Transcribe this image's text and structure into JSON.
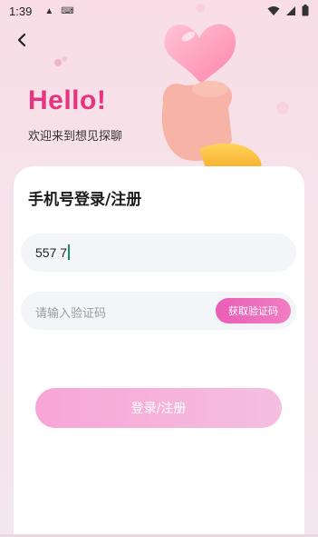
{
  "status_bar": {
    "time": "1:39",
    "icons": [
      "notification-a-icon",
      "keyboard-icon",
      "wifi-icon",
      "signal-icon",
      "battery-icon"
    ]
  },
  "header": {
    "back_icon": "chevron-left-icon",
    "greeting": "Hello!",
    "welcome": "欢迎来到想见探聊"
  },
  "login": {
    "title": "手机号登录/注册",
    "phone_value": "557 7",
    "code_placeholder": "请输入验证码",
    "get_code_label": "获取验证码",
    "submit_label": "登录/注册"
  },
  "colors": {
    "accent": "#e8337e",
    "button_gradient_start": "#ea5eb6",
    "button_gradient_end": "#f07ec3"
  }
}
